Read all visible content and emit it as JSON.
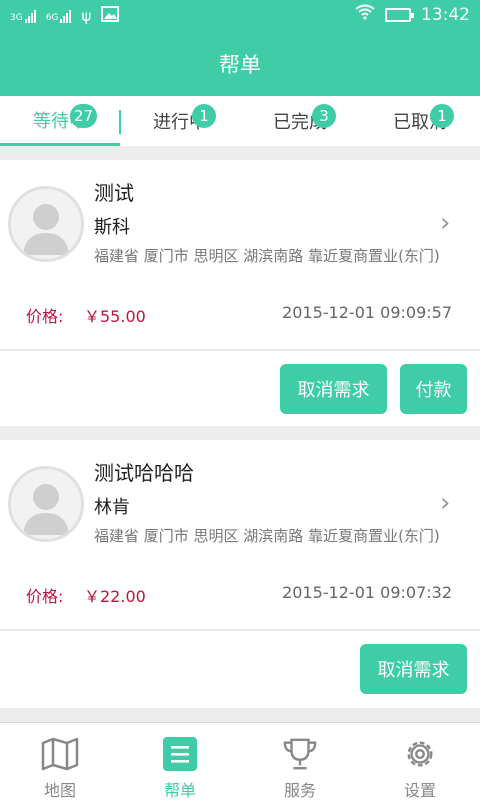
{
  "statusbar": {
    "net1": "3G",
    "net2": "6G",
    "time": "13:42"
  },
  "header": {
    "title": "帮单"
  },
  "tabs": [
    {
      "label": "等待中",
      "badge": "27"
    },
    {
      "label": "进行中",
      "badge": "1"
    },
    {
      "label": "已完成",
      "badge": "3"
    },
    {
      "label": "已取消",
      "badge": "1"
    }
  ],
  "orders": [
    {
      "title": "测试",
      "name": "斯科",
      "address": "福建省 厦门市 思明区 湖滨南路 靠近夏商置业(东门)",
      "price_label": "价格:",
      "price": "￥55.00",
      "time": "2015-12-01 09:09:57",
      "buttons": [
        "取消需求",
        "付款"
      ]
    },
    {
      "title": "测试哈哈哈",
      "name": "林肯",
      "address": "福建省 厦门市 思明区 湖滨南路 靠近夏商置业(东门)",
      "price_label": "价格:",
      "price": "￥22.00",
      "time": "2015-12-01 09:07:32",
      "buttons": [
        "取消需求"
      ]
    }
  ],
  "tabbar": [
    {
      "label": "地图",
      "icon": "map-icon"
    },
    {
      "label": "帮单",
      "icon": "list-icon"
    },
    {
      "label": "服务",
      "icon": "trophy-icon"
    },
    {
      "label": "设置",
      "icon": "gear-icon"
    }
  ],
  "colors": {
    "accent": "#3ecda6",
    "price": "#c0143c"
  }
}
